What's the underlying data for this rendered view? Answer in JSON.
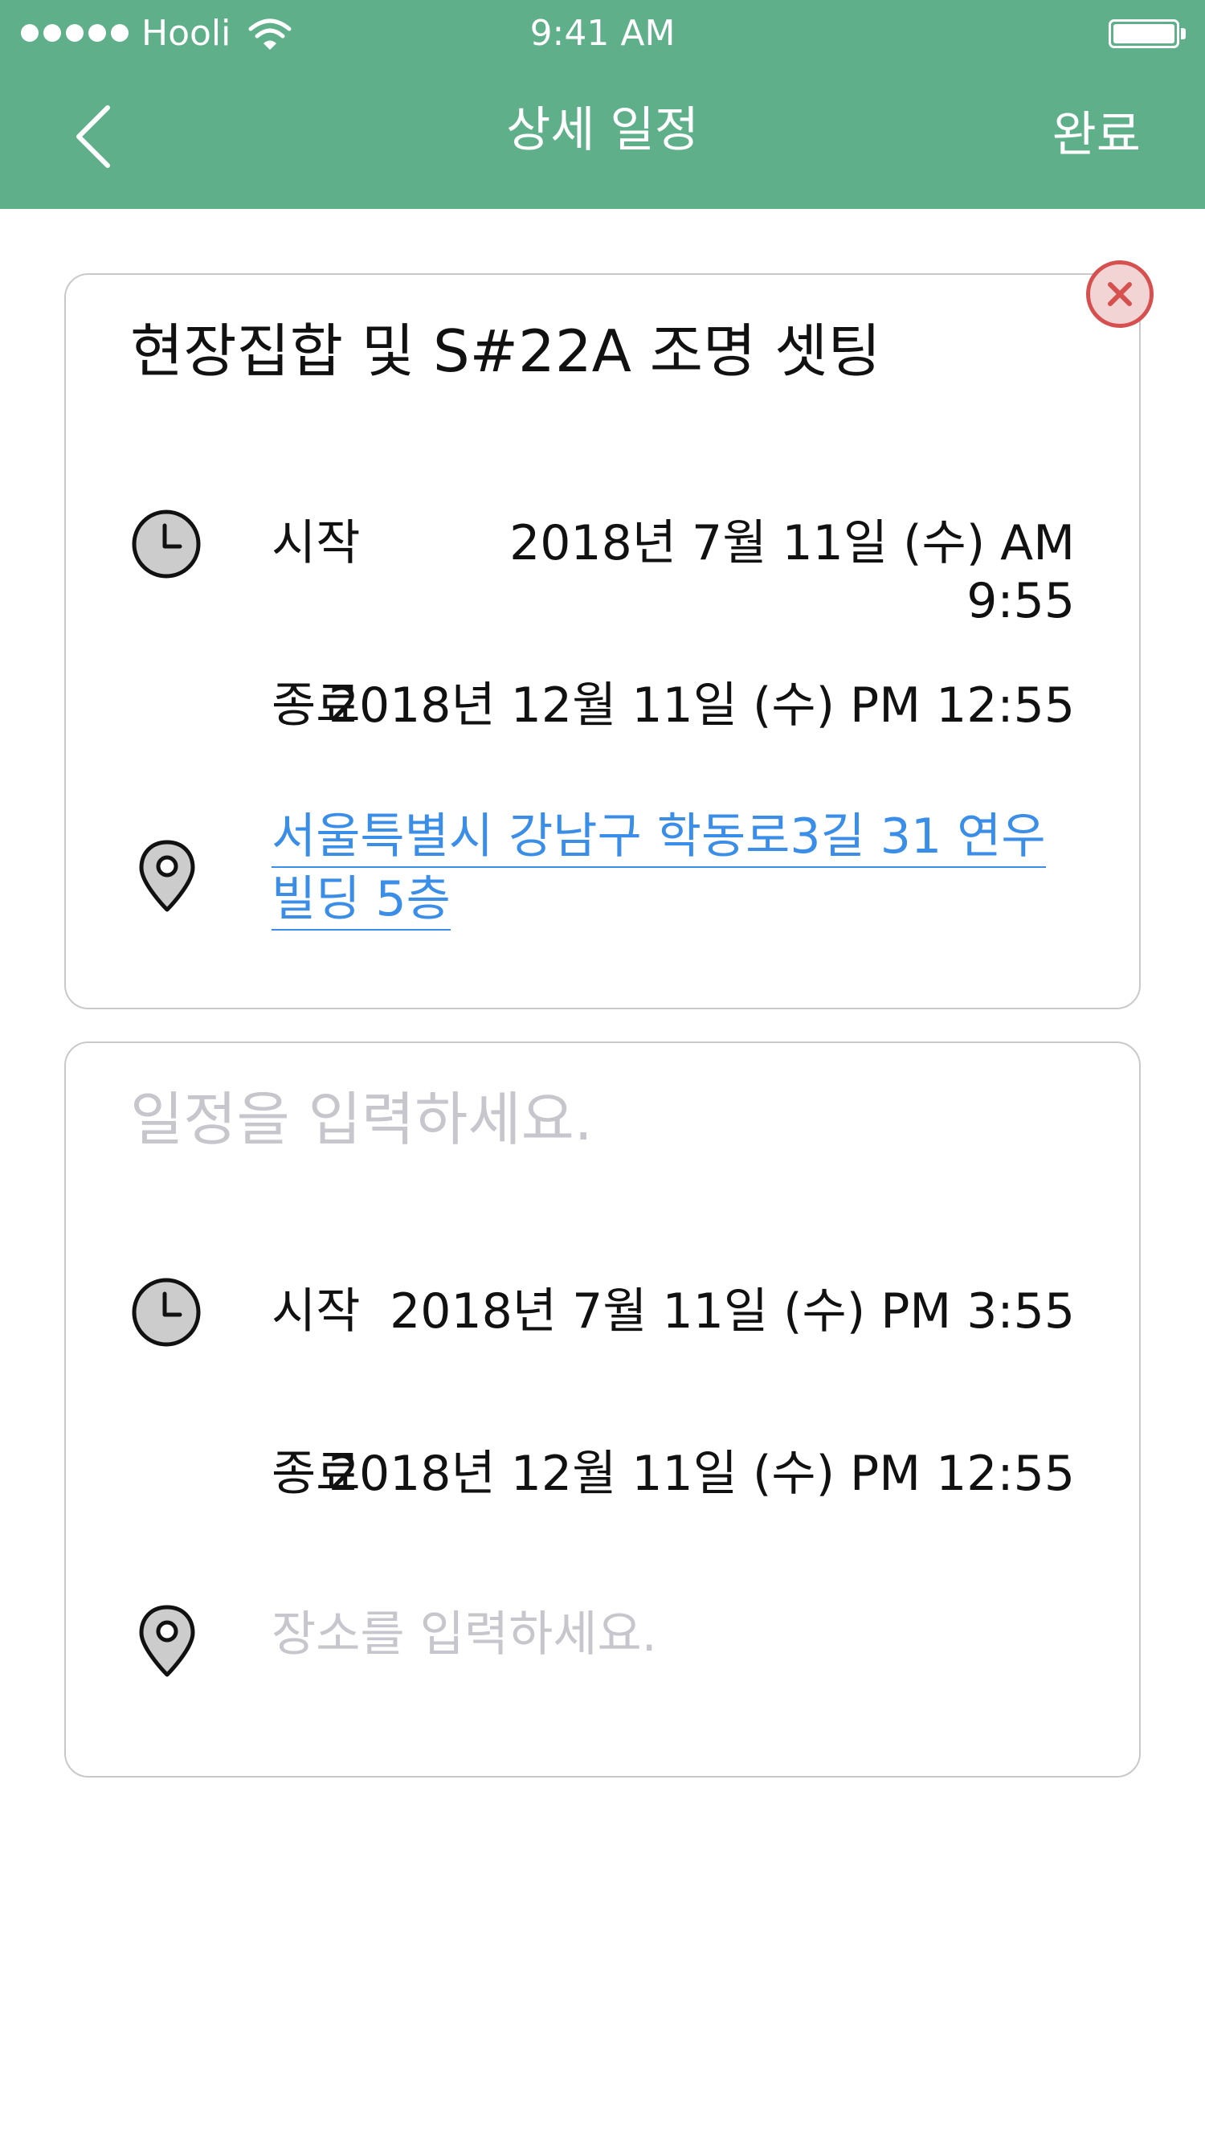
{
  "status_bar": {
    "carrier": "Hooli",
    "time": "9:41 AM"
  },
  "nav": {
    "title": "상세 일정",
    "done_label": "완료",
    "back_icon": "chevron-left-icon"
  },
  "colors": {
    "header": "#5fb08a",
    "link": "#3b8ee8",
    "placeholder": "#c6c6cc",
    "remove": "#d65050"
  },
  "events": [
    {
      "title": "현장집합 및 S#22A 조명 셋팅",
      "start_label": "시작",
      "start_value": "2018년 7월 11일 (수)  AM 9:55",
      "end_label": "종료",
      "end_value": "2018년 12월 11일 (수)  PM 12:55",
      "location": "서울특별시 강남구 학동로3길 31 연우 빌딩 5층",
      "location_line1": "서울특별시 강남구 학동로3길 31 연우",
      "location_line2": "빌딩 5층"
    },
    {
      "title_placeholder": "일정을 입력하세요.",
      "start_label": "시작",
      "start_value": "2018년 7월 11일 (수)  PM 3:55",
      "end_label": "종료",
      "end_value": "2018년 12월 11일 (수)  PM 12:55",
      "location_placeholder": "장소를 입력하세요."
    }
  ]
}
